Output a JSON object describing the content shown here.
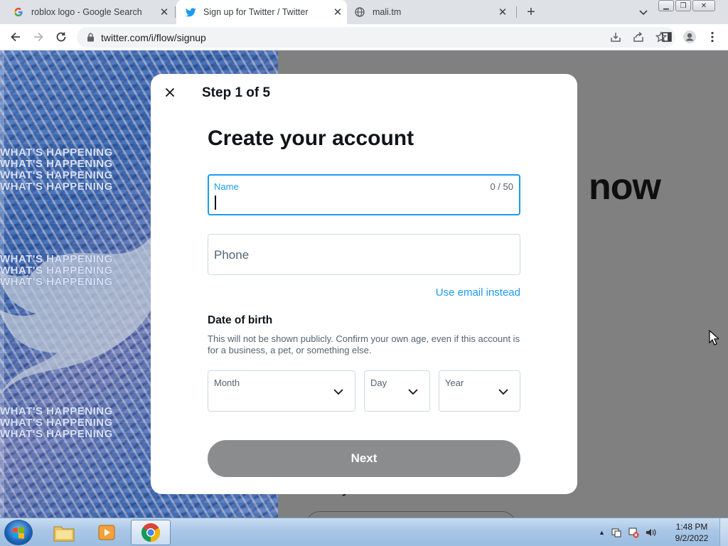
{
  "browser": {
    "tabs": [
      {
        "title": "roblox logo - Google Search",
        "icon": "google-icon",
        "active": false
      },
      {
        "title": "Sign up for Twitter / Twitter",
        "icon": "twitter-bird-icon",
        "active": true
      },
      {
        "title": "mali.tm",
        "icon": "globe-icon",
        "active": false
      }
    ],
    "new_tab": "+",
    "url": "twitter.com/i/flow/signup"
  },
  "background": {
    "headline": "now",
    "already_text": "Already have an account?",
    "poster_text": "WHAT'S HAPPENING"
  },
  "modal": {
    "step": "Step 1 of 5",
    "heading": "Create your account",
    "name_label": "Name",
    "name_counter": "0 / 50",
    "phone_placeholder": "Phone",
    "email_link": "Use email instead",
    "dob_title": "Date of birth",
    "dob_description": "This will not be shown publicly. Confirm your own age, even if this account is for a business, a pet, or something else.",
    "month_label": "Month",
    "day_label": "Day",
    "year_label": "Year",
    "next_label": "Next"
  },
  "colors": {
    "accent": "#1d9bf0",
    "next_disabled": "#8b8c8e",
    "overlay": "#808080"
  },
  "taskbar": {
    "time": "1:48 PM",
    "date": "9/2/2022"
  }
}
